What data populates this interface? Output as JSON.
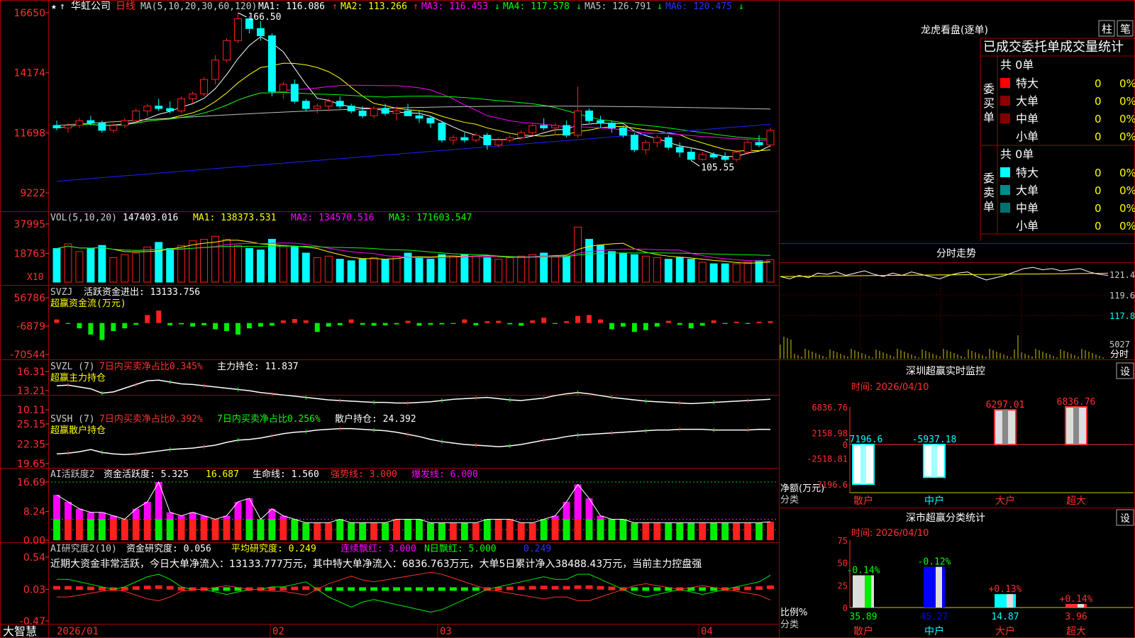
{
  "app": {
    "brand": "大智慧",
    "stock_name": "华虹公司",
    "period": "日线"
  },
  "colors": {
    "up": "#ff2020",
    "down": "#00ffff",
    "bg": "#000000",
    "grid": "#a00000",
    "ma1": "#ffffff",
    "ma2": "#ffff00",
    "ma3": "#ff00ff",
    "ma4": "#00ff00",
    "ma5": "#c0c0c0",
    "ma6": "#2020ff"
  },
  "price_header": {
    "title": "MA(5,10,20,30,60,120)",
    "ma1": "MA1: 116.086",
    "ma1_arrow": "↑",
    "ma2": "MA2: 113.266",
    "ma2_arrow": "↑",
    "ma3": "MA3: 116.453",
    "ma3_arrow": "↓",
    "ma4": "MA4: 117.578",
    "ma4_arrow": "↓",
    "ma5": "MA5: 126.791",
    "ma5_arrow": "↓",
    "ma6": "MA6: 120.475",
    "ma6_arrow": "↓"
  },
  "price_ticks": [
    "16650",
    "14174",
    "11698",
    "9222"
  ],
  "annotations": {
    "high": "166.50",
    "low": "105.55"
  },
  "vol_header": {
    "title": "VOL(5,10,20)",
    "value": "147403.016",
    "ma1": "MA1: 138373.531",
    "ma2": "MA2: 134570.516",
    "ma3": "MA3: 171603.547",
    "unit": "X10"
  },
  "vol_ticks": [
    "37995",
    "18763"
  ],
  "svzj_header": {
    "title": "SVZJ",
    "label": "活跃资金进出: 13133.756",
    "subtitle": "超赢资金流(万元)"
  },
  "svzj_ticks": [
    "56786",
    "-6879",
    "-70544"
  ],
  "svzl_header": {
    "title": "SVZL (7)",
    "label1": "7日内买卖净占比0.345%",
    "label2": "主力持仓: 11.837",
    "subtitle": "超赢主力持仓"
  },
  "svzl_ticks": [
    "16.31",
    "13.21",
    "10.11"
  ],
  "svsh_header": {
    "title": "SVSH (7)",
    "label1": "7日内买卖净占比0.392%",
    "label2": "7日内买卖净占比0.256%",
    "label3": "散户持仓: 24.392",
    "subtitle": "超赢散户持仓"
  },
  "svsh_ticks": [
    "25.15",
    "22.35",
    "19.65"
  ],
  "ai1_header": {
    "title": "AI活跃度2",
    "label1": "资金活跃度: 5.325",
    "label2": "16.687",
    "label3": "生命线: 1.560",
    "label4": "强势线: 3.000",
    "label5": "爆发线: 6.000"
  },
  "ai1_ticks": [
    "16.69",
    "8.24",
    "0.00"
  ],
  "ai2_header": {
    "title": "AI研究度2(10)",
    "label1": "资金研究度: 0.056",
    "label2": "平均研究度: 0.249",
    "label3": "连续飘红: 3.000",
    "label4": "N日飘红: 5.000",
    "label5": "0.249",
    "commentary": "近期大资金非常活跃，今日大单净流入：13133.777万元，其中特大单净流入：6836.763万元，大单5日累计净入38488.43万元，当前主力控盘强"
  },
  "ai2_ticks": [
    "0.54",
    "0.03",
    "-0.47"
  ],
  "date_axis": [
    "2026/01",
    "02",
    "03",
    "04"
  ],
  "right_top": {
    "title": "龙虎看盘(逐单)",
    "btn_col": "柱",
    "btn_pen": "笔",
    "header": "已成交委托单成交量统计",
    "buy_label": "委买单",
    "sell_label": "委卖单",
    "buy_total": "共 0单",
    "sell_total": "共 0单",
    "rows": [
      "特大",
      "大单",
      "中单",
      "小单"
    ],
    "zero": "0",
    "pct": "0%"
  },
  "intraday": {
    "title": "分时走势",
    "ticks": [
      "121.4",
      "119.6",
      "117.8",
      "5027"
    ],
    "unit": "分时"
  },
  "monitor": {
    "title": "深圳超赢实时监控",
    "settings": "设",
    "time": "时间: 2026/04/10",
    "ticks": [
      "6836.76",
      "2158.98",
      "0",
      "-2518.81",
      "-7196.6"
    ],
    "ylabel": "净额(万元)",
    "xlabel": "分类",
    "categories": [
      "散户",
      "中户",
      "大户",
      "超大"
    ],
    "value_labels": [
      "-7196.6",
      "-5937.18",
      "6297.01",
      "6836.76"
    ]
  },
  "classify": {
    "title": "深市超赢分类统计",
    "settings": "设",
    "time": "时间: 2026/04/10",
    "ticks": [
      "75",
      "50",
      "25",
      "0"
    ],
    "ylabel": "比例%",
    "xlabel": "分类",
    "categories": [
      "散户",
      "中户",
      "大户",
      "超大"
    ],
    "change_labels": [
      "-0.14%",
      "-0.12%",
      "+0.13%",
      "+0.14%"
    ],
    "value_labels": [
      "35.89",
      "45.27",
      "14.87",
      "3.96"
    ]
  },
  "chart_data": [
    {
      "type": "candlestick",
      "title": "华虹公司 日线",
      "ylim": [
        92.22,
        166.5
      ],
      "x_range": [
        "2026/01",
        "2026/04/10"
      ],
      "ohlc": [
        [
          120,
          122,
          118,
          119
        ],
        [
          119,
          121,
          117,
          120
        ],
        [
          120,
          123,
          119,
          122
        ],
        [
          122,
          124,
          120,
          121
        ],
        [
          121,
          122,
          117,
          118
        ],
        [
          118,
          121,
          117,
          120
        ],
        [
          120,
          123,
          119,
          122
        ],
        [
          122,
          127,
          121,
          126
        ],
        [
          126,
          129,
          124,
          128
        ],
        [
          128,
          131,
          126,
          127
        ],
        [
          127,
          130,
          125,
          126
        ],
        [
          126,
          132,
          125,
          131
        ],
        [
          131,
          134,
          129,
          133
        ],
        [
          133,
          140,
          132,
          139
        ],
        [
          139,
          149,
          137,
          147
        ],
        [
          147,
          156,
          146,
          155
        ],
        [
          155,
          166.5,
          154,
          164
        ],
        [
          164,
          165,
          158,
          160
        ],
        [
          160,
          163,
          155,
          157
        ],
        [
          157,
          158,
          132,
          134
        ],
        [
          134,
          138,
          131,
          137
        ],
        [
          137,
          139,
          129,
          130
        ],
        [
          130,
          131,
          126,
          127
        ],
        [
          127,
          129,
          125,
          128
        ],
        [
          128,
          131,
          126,
          130
        ],
        [
          130,
          132,
          127,
          128
        ],
        [
          128,
          129,
          125,
          126
        ],
        [
          126,
          128,
          123,
          124
        ],
        [
          124,
          128,
          123,
          127
        ],
        [
          127,
          129,
          124,
          125
        ],
        [
          125,
          128,
          122,
          126
        ],
        [
          126,
          129,
          124,
          124
        ],
        [
          124,
          126,
          121,
          123
        ],
        [
          123,
          124,
          119,
          121
        ],
        [
          121,
          122,
          113,
          114
        ],
        [
          114,
          116,
          112,
          115
        ],
        [
          115,
          117,
          113,
          114
        ],
        [
          114,
          117,
          113,
          116
        ],
        [
          116,
          117,
          110,
          112
        ],
        [
          112,
          115,
          111,
          114
        ],
        [
          114,
          116,
          113,
          115
        ],
        [
          115,
          118,
          114,
          117
        ],
        [
          117,
          121,
          116,
          120
        ],
        [
          120,
          123,
          118,
          119
        ],
        [
          119,
          121,
          116,
          120
        ],
        [
          120,
          122,
          115,
          116
        ],
        [
          116,
          136,
          115,
          126
        ],
        [
          126,
          127,
          121,
          122
        ],
        [
          122,
          124,
          119,
          121
        ],
        [
          121,
          122,
          117,
          119
        ],
        [
          119,
          120,
          115,
          116
        ],
        [
          116,
          117,
          109,
          110
        ],
        [
          110,
          114,
          108,
          113
        ],
        [
          113,
          116,
          111,
          115
        ],
        [
          115,
          116,
          110,
          111
        ],
        [
          111,
          113,
          107,
          109
        ],
        [
          109,
          111,
          105.55,
          106
        ],
        [
          106,
          109,
          105.55,
          108
        ],
        [
          108,
          109,
          106,
          107
        ],
        [
          107,
          109,
          105,
          106
        ],
        [
          106,
          110,
          105,
          109
        ],
        [
          109,
          114,
          108,
          113
        ],
        [
          113,
          116,
          111,
          112
        ],
        [
          112,
          119,
          111,
          118
        ]
      ]
    },
    {
      "type": "bar",
      "title": "VOL(5,10,20)",
      "unit": "X10",
      "ylim": [
        0,
        37995
      ],
      "values": [
        22000,
        25000,
        20000,
        22000,
        24000,
        16000,
        18000,
        19000,
        23000,
        26000,
        22000,
        24000,
        27000,
        28000,
        30000,
        28000,
        24000,
        22000,
        21000,
        28000,
        24000,
        23000,
        19000,
        16000,
        17000,
        15000,
        14000,
        15000,
        16000,
        15000,
        17000,
        19000,
        16000,
        15000,
        18000,
        17000,
        18000,
        17000,
        16000,
        15000,
        16000,
        17000,
        18000,
        19000,
        17000,
        17000,
        36000,
        28000,
        24000,
        20000,
        19000,
        18000,
        17000,
        16000,
        15000,
        16000,
        15000,
        13000,
        12000,
        12000,
        12000,
        13000,
        14000,
        14700
      ]
    },
    {
      "type": "bar",
      "title": "SVZJ 活跃资金进出",
      "ylim": [
        -70544,
        56786
      ],
      "values": [
        8000,
        -2000,
        -12000,
        -26000,
        -38000,
        -18000,
        -12000,
        -4000,
        18000,
        28000,
        -5000,
        -3000,
        -8000,
        -5000,
        -14000,
        -18000,
        -26000,
        -12000,
        -8000,
        -6000,
        6000,
        9000,
        6000,
        -20000,
        -8000,
        -5000,
        8000,
        -4000,
        -6000,
        -5000,
        -3000,
        5000,
        -6000,
        -4000,
        -3000,
        -2000,
        8000,
        -5000,
        4000,
        5000,
        -3000,
        -6000,
        6000,
        12000,
        -2000,
        4000,
        16000,
        18000,
        8000,
        -14000,
        -8000,
        -20000,
        -16000,
        -8000,
        5000,
        -4000,
        -12000,
        -6000,
        6000,
        -2000,
        3000,
        -2000,
        3000,
        4000
      ]
    },
    {
      "type": "line",
      "title": "SVZL (7) 主力持仓",
      "ylim": [
        10.11,
        16.31
      ],
      "values": [
        14.0,
        14.1,
        13.8,
        13.5,
        12.8,
        13.0,
        13.6,
        14.2,
        14.8,
        14.9,
        14.6,
        14.3,
        14.2,
        14.0,
        13.8,
        13.6,
        13.4,
        13.2,
        12.9,
        12.7,
        12.5,
        12.3,
        12.1,
        11.9,
        11.7,
        11.6,
        11.5,
        11.4,
        11.3,
        11.3,
        11.2,
        11.2,
        11.3,
        11.4,
        11.6,
        11.8,
        11.9,
        12.0,
        12.1,
        11.9,
        11.7,
        11.6,
        11.8,
        12.0,
        12.4,
        12.7,
        12.9,
        12.7,
        12.4,
        12.1,
        11.9,
        11.7,
        11.5,
        11.4,
        11.3,
        11.2,
        11.1,
        11.2,
        11.3,
        11.4,
        11.5,
        11.6,
        11.7,
        11.8
      ]
    },
    {
      "type": "line",
      "title": "SVSH (7) 散户持仓",
      "ylim": [
        19.65,
        25.15
      ],
      "values": [
        21.0,
        21.1,
        21.3,
        21.6,
        21.2,
        21.0,
        20.9,
        21.0,
        21.2,
        21.4,
        21.6,
        21.7,
        21.8,
        22.0,
        22.2,
        22.6,
        22.9,
        23.0,
        23.2,
        23.5,
        23.8,
        24.0,
        24.1,
        24.3,
        24.4,
        24.5,
        24.5,
        24.4,
        24.3,
        24.2,
        24.0,
        23.7,
        23.4,
        23.0,
        22.7,
        22.5,
        22.3,
        22.2,
        22.1,
        22.0,
        22.1,
        22.3,
        22.6,
        22.9,
        23.1,
        23.4,
        23.6,
        23.7,
        23.8,
        23.9,
        24.0,
        24.1,
        24.2,
        24.3,
        24.3,
        24.4,
        24.4,
        24.4,
        24.3,
        24.3,
        24.3,
        24.3,
        24.4,
        24.39
      ]
    },
    {
      "type": "bar",
      "title": "AI活跃度2 资金活跃度",
      "ylim": [
        0,
        16.69
      ],
      "values": [
        13,
        11,
        9,
        8,
        8,
        7,
        6,
        9,
        11,
        16.69,
        8,
        7,
        8,
        7,
        6,
        7,
        11,
        12,
        6,
        9,
        7,
        6,
        5,
        5,
        5,
        6,
        5,
        5,
        5,
        5,
        6,
        6,
        6,
        5,
        5,
        5,
        5,
        5,
        6,
        6,
        6,
        5,
        5,
        6,
        7,
        11,
        16,
        12,
        7,
        6,
        6,
        5,
        5,
        5,
        5,
        5,
        5,
        5,
        5,
        5,
        5,
        5,
        5,
        5.3
      ]
    },
    {
      "type": "bar",
      "title": "AI研究度2(10) 资金研究度",
      "ylim": [
        -0.47,
        0.54
      ],
      "values": [
        0.04,
        0.04,
        0.03,
        0.02,
        0.01,
        0.0,
        0.01,
        0.03,
        0.05,
        0.06,
        0.04,
        0.01,
        0.0,
        0.0,
        -0.01,
        -0.02,
        -0.01,
        0.0,
        0.0,
        0.01,
        0.01,
        0.02,
        0.03,
        0.0,
        -0.03,
        -0.05,
        -0.07,
        -0.05,
        -0.04,
        -0.05,
        -0.06,
        -0.07,
        -0.08,
        -0.09,
        -0.08,
        -0.06,
        -0.04,
        -0.02,
        0.0,
        0.01,
        0.02,
        0.03,
        0.04,
        0.05,
        0.04,
        0.04,
        0.06,
        0.06,
        0.04,
        0.02,
        0.0,
        -0.02,
        -0.03,
        -0.02,
        -0.01,
        0.0,
        -0.01,
        -0.02,
        -0.01,
        0.0,
        0.01,
        0.02,
        0.03,
        0.056
      ]
    },
    {
      "type": "bar",
      "title": "深圳超赢实时监控",
      "categories": [
        "散户",
        "中户",
        "大户",
        "超大"
      ],
      "values": [
        -7196.6,
        -5937.18,
        6297.01,
        6836.76
      ],
      "ylim": [
        -7196.6,
        6836.76
      ]
    },
    {
      "type": "bar",
      "title": "深市超赢分类统计",
      "categories": [
        "散户",
        "中户",
        "大户",
        "超大"
      ],
      "values": [
        35.89,
        45.27,
        14.87,
        3.96
      ],
      "ylim": [
        0,
        75
      ]
    },
    {
      "type": "line",
      "title": "分时走势",
      "ylim": [
        117.8,
        121.4
      ],
      "values": [
        121.2,
        121.0,
        121.3,
        121.1,
        121.5,
        121.4,
        121.6,
        121.3,
        121.5,
        121.7,
        121.4,
        121.2,
        121.5,
        121.3,
        121.6,
        121.4,
        121.2,
        121.0,
        121.3,
        121.5,
        121.6,
        121.2,
        120.9,
        121.1,
        121.3,
        121.6,
        121.9,
        122.0,
        121.8,
        121.9,
        121.7,
        121.8,
        121.9,
        121.6,
        121.4,
        121.3
      ]
    }
  ]
}
